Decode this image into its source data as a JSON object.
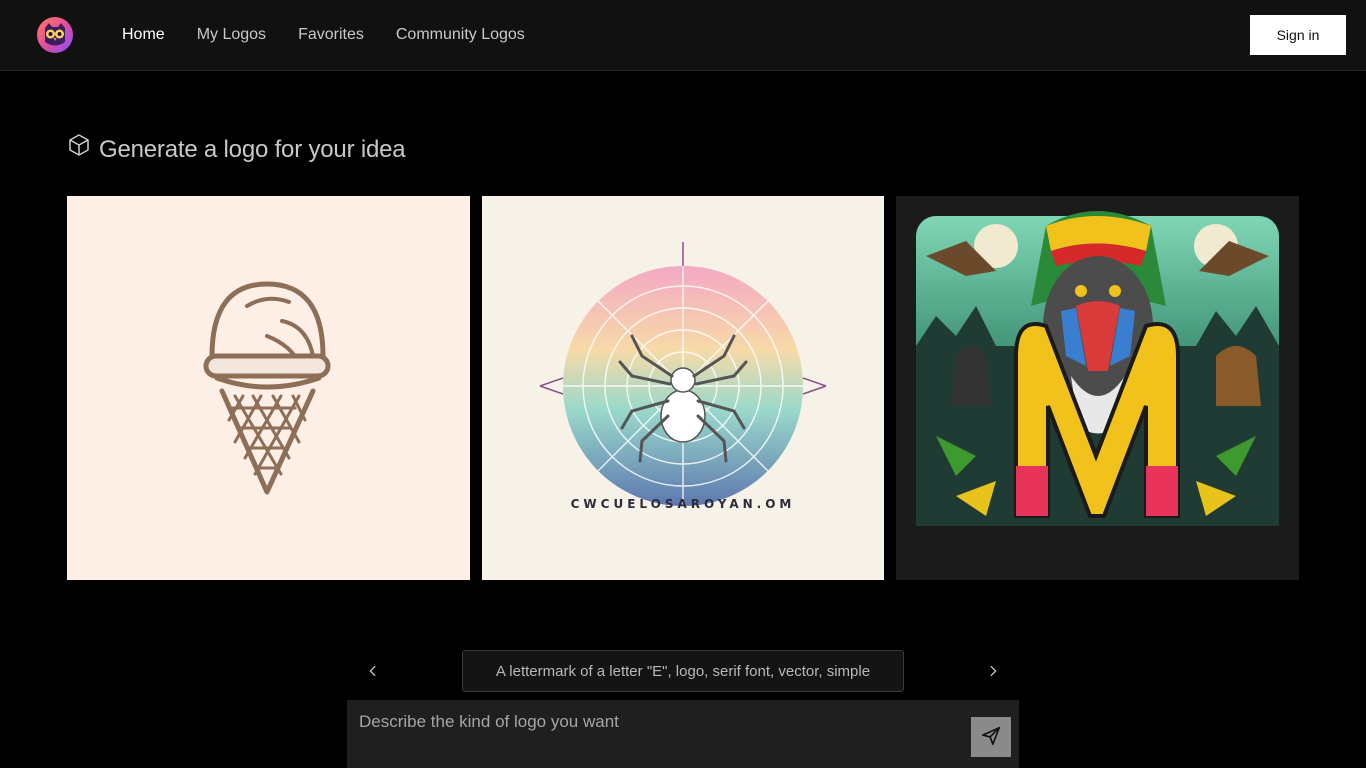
{
  "app": {
    "logo_icon": "owl-logo-icon"
  },
  "nav": {
    "items": [
      {
        "label": "Home",
        "active": true
      },
      {
        "label": "My Logos",
        "active": false
      },
      {
        "label": "Favorites",
        "active": false
      },
      {
        "label": "Community Logos",
        "active": false
      }
    ],
    "signin_label": "Sign in"
  },
  "hero": {
    "title": "Generate a logo for your idea",
    "title_icon": "cube-icon"
  },
  "gallery": {
    "images": [
      {
        "name": "ice-cream-logo",
        "description": "ice cream cone line logo"
      },
      {
        "name": "spider-web-logo",
        "description": "spider on web circle logo",
        "text": "CWCUELOSAROYAN.OM"
      },
      {
        "name": "baboon-m-logo",
        "description": "baboon with letter M logo"
      }
    ]
  },
  "suggestions": {
    "current": "A lettermark of a letter \"E\", logo, serif font, vector, simple",
    "prev_icon": "chevron-left-icon",
    "next_icon": "chevron-right-icon"
  },
  "prompt": {
    "placeholder": "Describe the kind of logo you want",
    "value": "",
    "send_icon": "send-icon"
  },
  "colors": {
    "background": "#000000",
    "topbar": "#111111",
    "send_button": "#8a8a8a"
  }
}
